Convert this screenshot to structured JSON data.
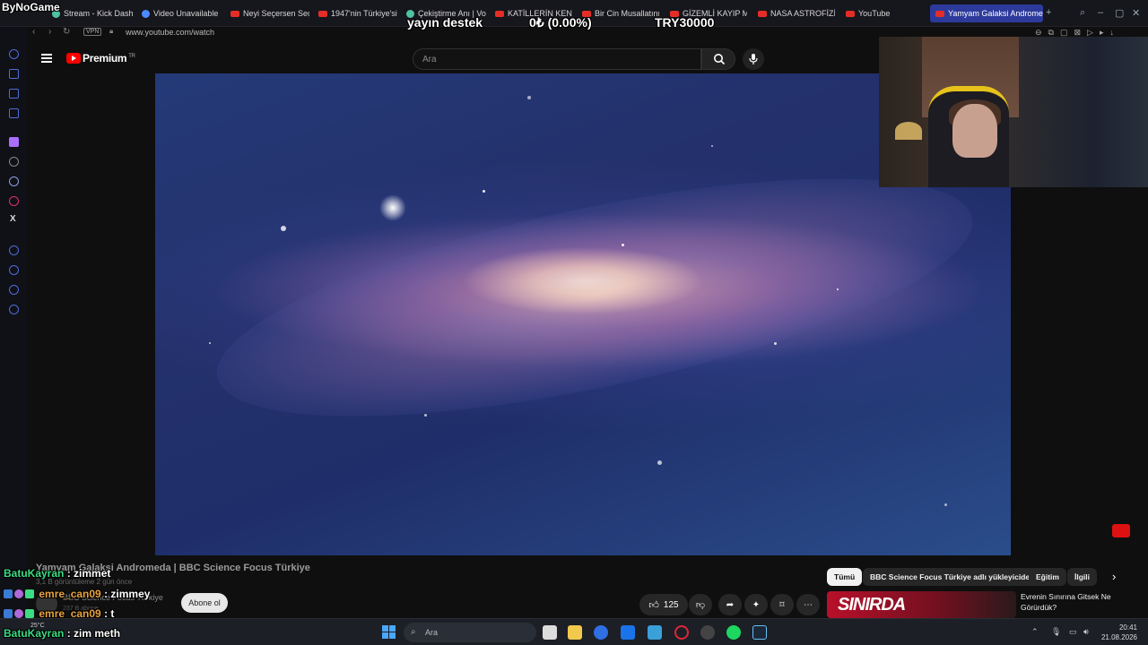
{
  "browser": {
    "tabs": [
      {
        "label": "Stream - Kick Dash",
        "icon": "kick-icon"
      },
      {
        "label": "Video Unavailable",
        "icon": "globe-icon"
      },
      {
        "label": "Neyi Seçersen Seç",
        "icon": "youtube-icon"
      },
      {
        "label": "1947'nin Türkiye'si",
        "icon": "youtube-icon"
      },
      {
        "label": "Çekiştirme Anı | Vo",
        "icon": "v-icon"
      },
      {
        "label": "KATİLLERİN KENDİ",
        "icon": "youtube-icon"
      },
      {
        "label": "Bir Cin Musallatını",
        "icon": "youtube-icon"
      },
      {
        "label": "GİZEMLİ KAYIP MU",
        "icon": "youtube-icon"
      },
      {
        "label": "NASA ASTROFİZİK",
        "icon": "youtube-icon"
      },
      {
        "label": "YouTube",
        "icon": "youtube-icon"
      },
      {
        "label": "Yamyam Galaksi Andromed",
        "icon": "youtube-icon",
        "active": true
      }
    ],
    "new_tab": "+",
    "address": "www.youtube.com/watch",
    "vpn_label": "VPN"
  },
  "stream_overlay": {
    "channel_name": "ByNoGame",
    "support_label": "yayın destek",
    "progress_text": "0₺ (0.00%)",
    "goal_text": "TRY30000"
  },
  "youtube": {
    "premium_label": "Premium",
    "region": "TR",
    "search_placeholder": "Ara",
    "video": {
      "title": "Yamyam Galaksi Andromeda | BBC Science Focus Türkiye",
      "meta": "3,1 B görüntüleme  2 gün önce",
      "channel": "BBC Science Focus Türkiye",
      "subscribers": "237 B abone",
      "subscribe_label": "Abone ol",
      "likes": "125"
    },
    "chips": [
      "Tümü",
      "BBC Science Focus Türkiye adlı yükleyiciden",
      "Eğitim",
      "İlgili"
    ],
    "recommended": {
      "thumb_text": "SINIRDA",
      "title": "Evrenin Sınırına Gitsek Ne Görürdük?"
    }
  },
  "chat": [
    {
      "user": "BatuKayran",
      "message": "zimmet",
      "color": "green"
    },
    {
      "user": "emre_can09",
      "message": "zimmey",
      "color": "orange"
    },
    {
      "user": "emre_can09",
      "message": "t",
      "color": "orange"
    },
    {
      "user": "BatuKayran",
      "message": "zim meth",
      "color": "green"
    }
  ],
  "taskbar": {
    "search_label": "Ara",
    "time": "20:41",
    "date": "21.08.2026",
    "weather": "25°C"
  }
}
